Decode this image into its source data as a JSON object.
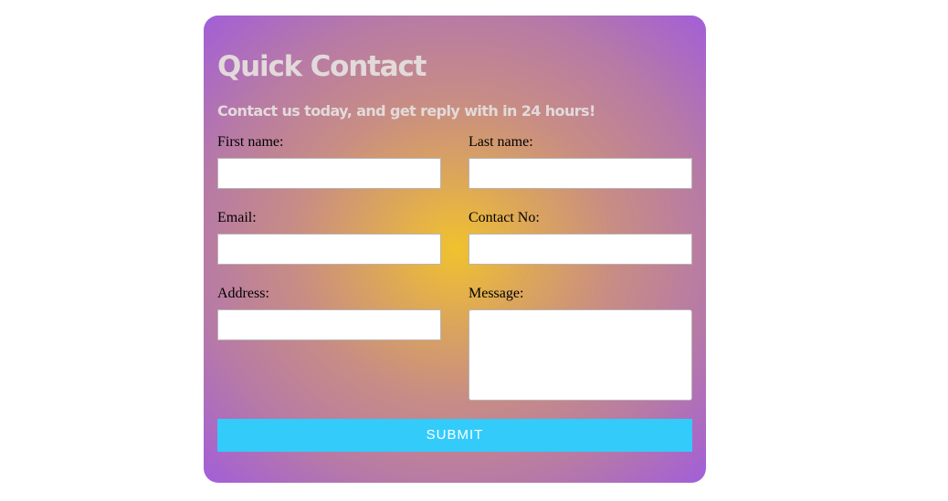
{
  "form": {
    "title": "Quick Contact",
    "subtitle": "Contact us today, and get reply with in 24 hours!",
    "fields": {
      "first_name": {
        "label": "First name:",
        "value": ""
      },
      "last_name": {
        "label": "Last name:",
        "value": ""
      },
      "email": {
        "label": "Email:",
        "value": ""
      },
      "contact_no": {
        "label": "Contact No:",
        "value": ""
      },
      "address": {
        "label": "Address:",
        "value": ""
      },
      "message": {
        "label": "Message:",
        "value": ""
      }
    },
    "submit_label": "SUBMIT"
  },
  "colors": {
    "gradient_center": "#f0c22e",
    "gradient_edge": "#a25ed9",
    "heading_text": "#e2dada",
    "submit_bg": "#33cbfa",
    "submit_text": "#ffffff"
  }
}
